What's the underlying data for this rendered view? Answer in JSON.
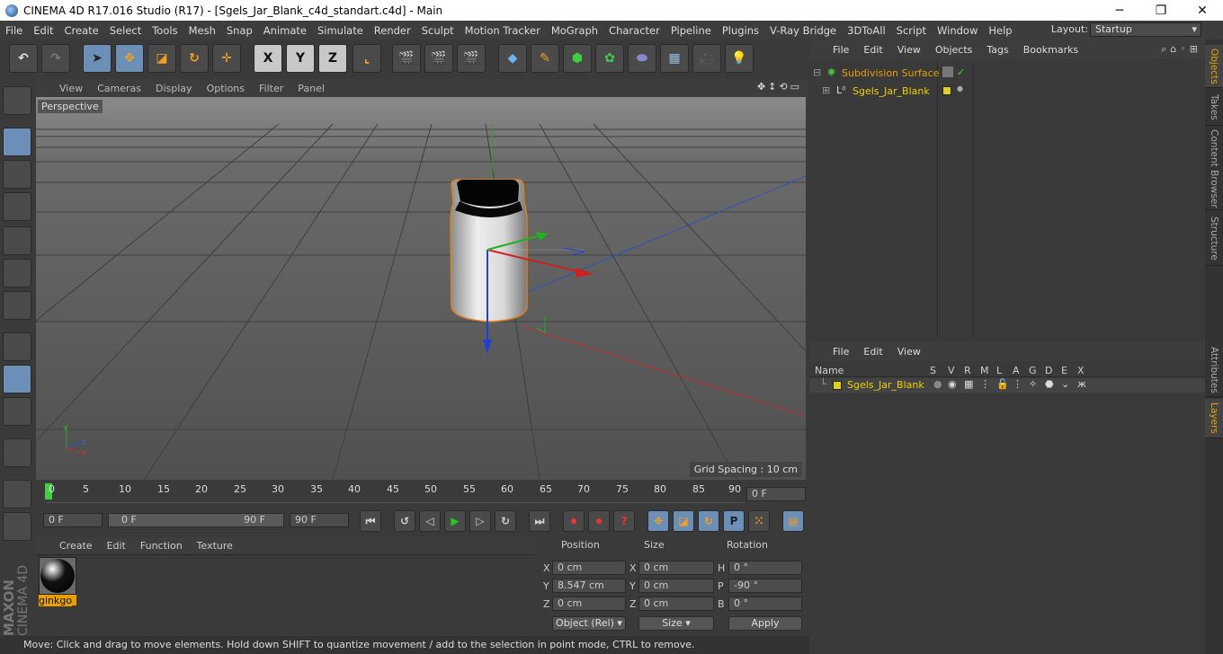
{
  "window": {
    "title": "CINEMA 4D R17.016 Studio (R17) - [Sgels_Jar_Blank_c4d_standart.c4d] - Main",
    "minimize": "─",
    "maximize": "❐",
    "close": "✕"
  },
  "menu": [
    "File",
    "Edit",
    "Create",
    "Select",
    "Tools",
    "Mesh",
    "Snap",
    "Animate",
    "Simulate",
    "Render",
    "Sculpt",
    "Motion Tracker",
    "MoGraph",
    "Character",
    "Pipeline",
    "Plugins",
    "V-Ray Bridge",
    "3DToAll",
    "Script",
    "Window",
    "Help"
  ],
  "layout": {
    "label": "Layout:",
    "value": "Startup"
  },
  "toolbar": {
    "x_label": "X",
    "y_label": "Y",
    "z_label": "Z"
  },
  "viewport": {
    "menu": [
      "View",
      "Cameras",
      "Display",
      "Options",
      "Filter",
      "Panel"
    ],
    "label": "Perspective",
    "grid_spacing": "Grid Spacing : 10 cm"
  },
  "timeline": {
    "ticks": [
      "0",
      "5",
      "10",
      "15",
      "20",
      "25",
      "30",
      "35",
      "40",
      "45",
      "50",
      "55",
      "60",
      "65",
      "70",
      "75",
      "80",
      "85",
      "90"
    ],
    "end_field": "0 F"
  },
  "playbar": {
    "start": "0 F",
    "range_start": "0 F",
    "range_end": "90 F",
    "end": "90 F"
  },
  "materials": {
    "menu": [
      "Create",
      "Edit",
      "Function",
      "Texture"
    ],
    "items": [
      {
        "name": "ginkgo_"
      }
    ]
  },
  "coords": {
    "headers": {
      "position": "Position",
      "size": "Size",
      "rotation": "Rotation"
    },
    "rows": [
      {
        "axis": "X",
        "pos": "0 cm",
        "size_axis": "X",
        "size": "0 cm",
        "rot_axis": "H",
        "rot": "0 °"
      },
      {
        "axis": "Y",
        "pos": "8.547 cm",
        "size_axis": "Y",
        "size": "0 cm",
        "rot_axis": "P",
        "rot": "-90 °"
      },
      {
        "axis": "Z",
        "pos": "0 cm",
        "size_axis": "Z",
        "size": "0 cm",
        "rot_axis": "B",
        "rot": "0 °"
      }
    ],
    "mode": "Object (Rel)",
    "size_mode": "Size",
    "apply": "Apply"
  },
  "status": "Move: Click and drag to move elements. Hold down SHIFT to quantize movement / add to the selection in point mode, CTRL to remove.",
  "objects": {
    "menu": [
      "File",
      "Edit",
      "View",
      "Objects",
      "Tags",
      "Bookmarks"
    ],
    "items": [
      {
        "name": "Subdivision Surface"
      },
      {
        "name": "Sgels_Jar_Blank"
      }
    ]
  },
  "layers": {
    "menu": [
      "File",
      "Edit",
      "View"
    ],
    "columns": {
      "name": "Name",
      "flags": [
        "S",
        "V",
        "R",
        "M",
        "L",
        "A",
        "G",
        "D",
        "E",
        "X"
      ]
    },
    "items": [
      {
        "name": "Sgels_Jar_Blank"
      }
    ]
  },
  "right_tabs": [
    "Objects",
    "Takes",
    "Content Browser",
    "Structure",
    "Attributes",
    "Layers"
  ],
  "brand": {
    "line1": "MAXON",
    "line2": "CINEMA 4D"
  },
  "colors": {
    "accent": "#e8a000",
    "selected_tool": "#6c8fb8",
    "layer": "#e0d020"
  }
}
